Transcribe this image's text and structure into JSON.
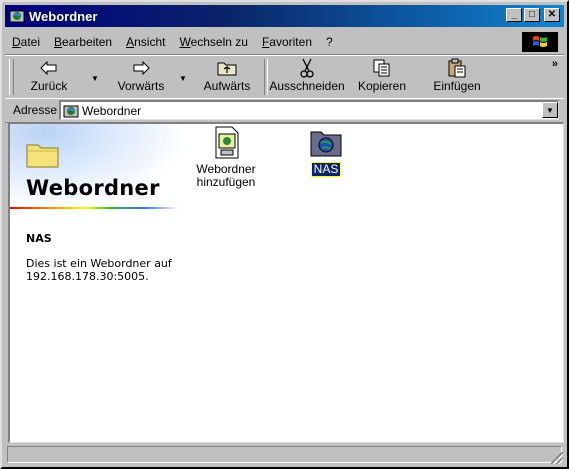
{
  "window": {
    "title": "Webordner",
    "icon": "webfolder-icon"
  },
  "titlebar_buttons": {
    "minimize": "_",
    "maximize": "□",
    "close": "✕"
  },
  "menu": [
    "Datei",
    "Bearbeiten",
    "Ansicht",
    "Wechseln zu",
    "Favoriten",
    "?"
  ],
  "toolbar": {
    "back": "Zurück",
    "forward": "Vorwärts",
    "up": "Aufwärts",
    "cut": "Ausschneiden",
    "copy": "Kopieren",
    "paste": "Einfügen",
    "more": "»"
  },
  "address": {
    "label": "Adresse",
    "value": "Webordner"
  },
  "webview": {
    "title": "Webordner",
    "selected_name": "NAS",
    "description": "Dies ist ein Webordner auf 192.168.178.30:5005."
  },
  "items": [
    {
      "label": "Webordner hinzufügen",
      "icon": "add-webfolder-icon"
    },
    {
      "label": "NAS",
      "icon": "network-folder-icon",
      "selected": true
    }
  ],
  "colors": {
    "titlebar_start": "#00007f",
    "titlebar_end": "#1084d0",
    "selection": "#0a246a",
    "desktop": "#008080"
  }
}
